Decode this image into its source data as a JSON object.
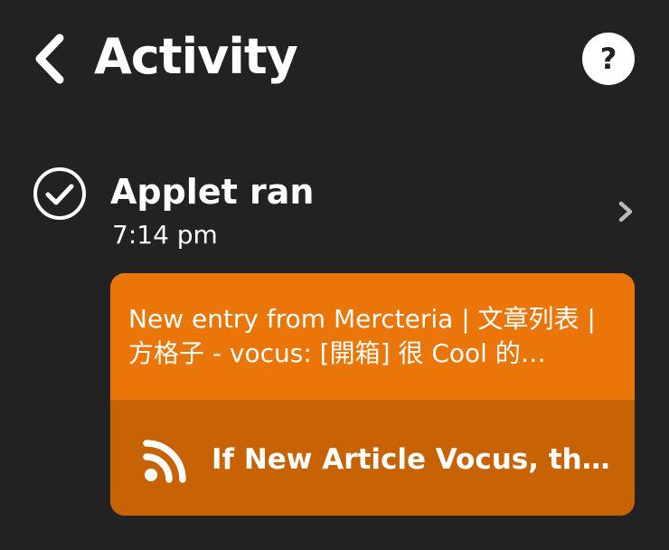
{
  "header": {
    "title": "Activity",
    "back_icon": "chevron-left-icon",
    "help_label": "?"
  },
  "activity": {
    "status_icon": "check-circle-icon",
    "title": "Applet ran",
    "time": "7:14 pm",
    "detail_icon": "chevron-right-icon"
  },
  "card": {
    "text": "New entry from Mercteria | 文章列表 | 方格子 - vocus: [開箱] 很 Cool 的…",
    "service_icon": "rss-icon",
    "applet_name": "If New Article Vocus, th…",
    "color_top": "#ea7509",
    "color_bottom": "#c76304"
  }
}
